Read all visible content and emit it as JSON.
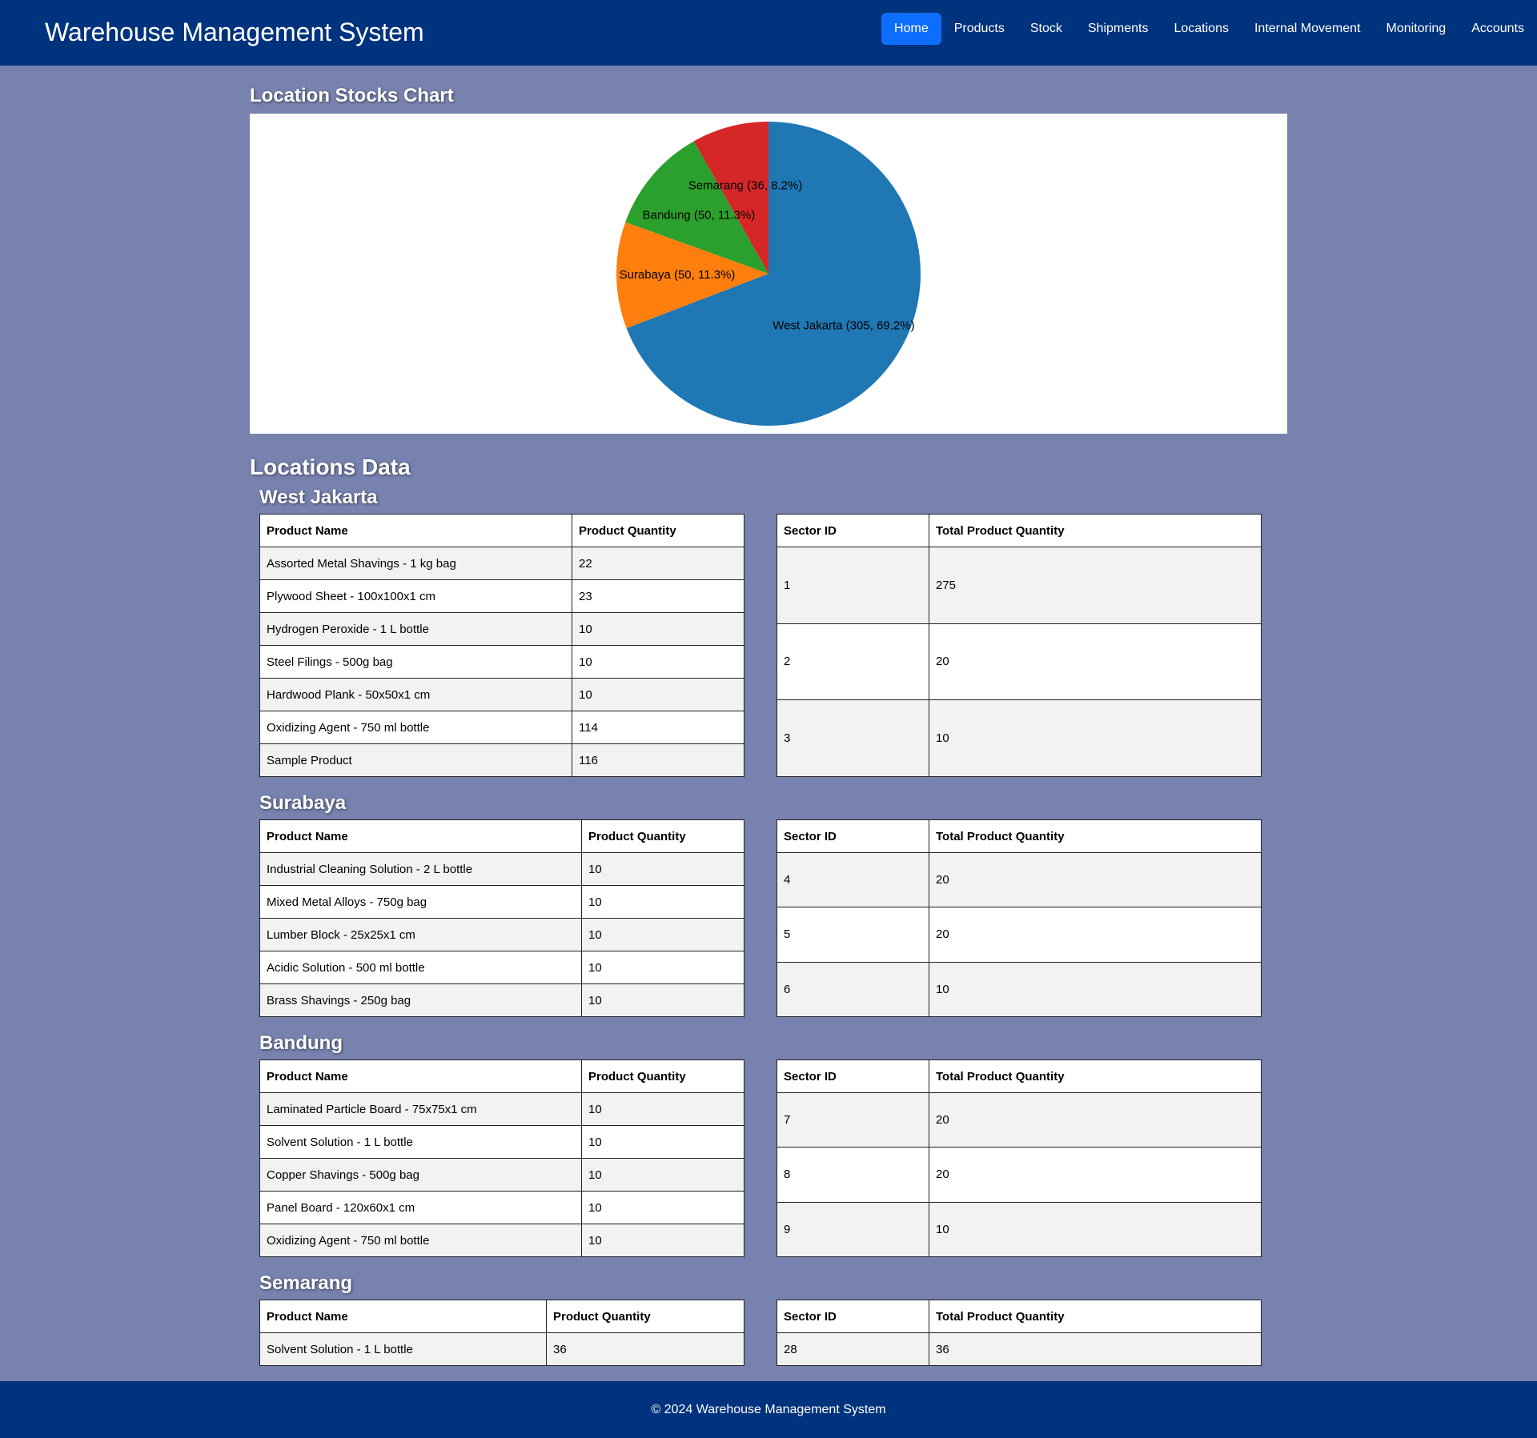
{
  "header": {
    "brand": "Warehouse Management System",
    "nav": [
      "Home",
      "Products",
      "Stock",
      "Shipments",
      "Locations",
      "Internal Movement",
      "Monitoring",
      "Accounts"
    ],
    "active": "Home"
  },
  "chart_section": {
    "title": "Location Stocks Chart"
  },
  "chart_data": {
    "type": "pie",
    "slices": [
      {
        "label": "West Jakarta (305, 69.2%)",
        "value": 305,
        "color": "#1f77b4"
      },
      {
        "label": "Surabaya (50, 11.3%)",
        "value": 50,
        "color": "#ff7f0e"
      },
      {
        "label": "Bandung (50, 11.3%)",
        "value": 50,
        "color": "#2ca02c"
      },
      {
        "label": "Semarang (36, 8.2%)",
        "value": 36,
        "color": "#d62728"
      }
    ]
  },
  "locations_section": {
    "title": "Locations Data"
  },
  "table_headers": {
    "product_name": "Product Name",
    "product_quantity": "Product Quantity",
    "sector_id": "Sector ID",
    "total_product_quantity": "Total Product Quantity"
  },
  "locations": [
    {
      "name": "West Jakarta",
      "products": [
        [
          "Assorted Metal Shavings - 1 kg bag",
          "22"
        ],
        [
          "Plywood Sheet - 100x100x1 cm",
          "23"
        ],
        [
          "Hydrogen Peroxide - 1 L bottle",
          "10"
        ],
        [
          "Steel Filings - 500g bag",
          "10"
        ],
        [
          "Hardwood Plank - 50x50x1 cm",
          "10"
        ],
        [
          "Oxidizing Agent - 750 ml bottle",
          "114"
        ],
        [
          "Sample Product",
          "116"
        ]
      ],
      "sectors": [
        [
          "1",
          "275"
        ],
        [
          "2",
          "20"
        ],
        [
          "3",
          "10"
        ]
      ]
    },
    {
      "name": "Surabaya",
      "products": [
        [
          "Industrial Cleaning Solution - 2 L bottle",
          "10"
        ],
        [
          "Mixed Metal Alloys - 750g bag",
          "10"
        ],
        [
          "Lumber Block - 25x25x1 cm",
          "10"
        ],
        [
          "Acidic Solution - 500 ml bottle",
          "10"
        ],
        [
          "Brass Shavings - 250g bag",
          "10"
        ]
      ],
      "sectors": [
        [
          "4",
          "20"
        ],
        [
          "5",
          "20"
        ],
        [
          "6",
          "10"
        ]
      ]
    },
    {
      "name": "Bandung",
      "products": [
        [
          "Laminated Particle Board - 75x75x1 cm",
          "10"
        ],
        [
          "Solvent Solution - 1 L bottle",
          "10"
        ],
        [
          "Copper Shavings - 500g bag",
          "10"
        ],
        [
          "Panel Board - 120x60x1 cm",
          "10"
        ],
        [
          "Oxidizing Agent - 750 ml bottle",
          "10"
        ]
      ],
      "sectors": [
        [
          "7",
          "20"
        ],
        [
          "8",
          "20"
        ],
        [
          "9",
          "10"
        ]
      ]
    },
    {
      "name": "Semarang",
      "products": [
        [
          "Solvent Solution - 1 L bottle",
          "36"
        ]
      ],
      "sectors": [
        [
          "28",
          "36"
        ]
      ]
    }
  ],
  "footer": {
    "text": "© 2024 Warehouse Management System"
  }
}
